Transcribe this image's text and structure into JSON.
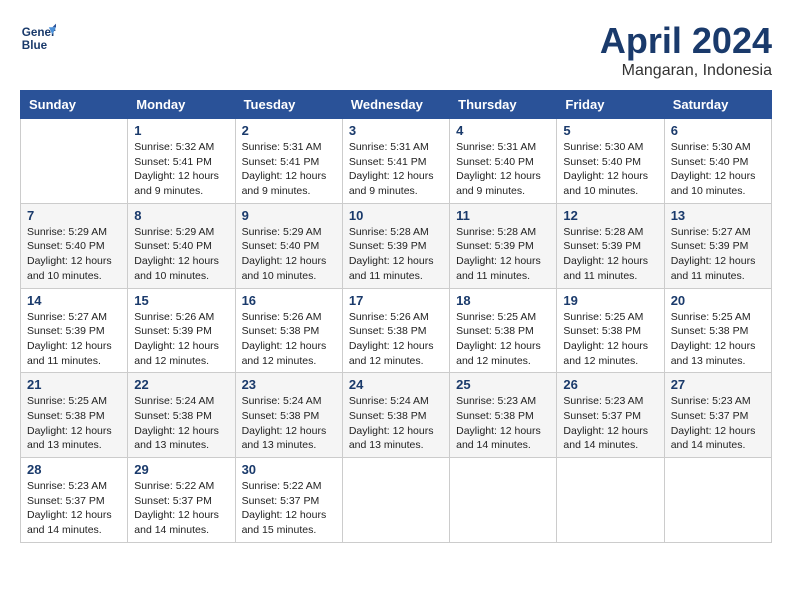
{
  "header": {
    "logo_line1": "General",
    "logo_line2": "Blue",
    "month": "April 2024",
    "location": "Mangaran, Indonesia"
  },
  "days_of_week": [
    "Sunday",
    "Monday",
    "Tuesday",
    "Wednesday",
    "Thursday",
    "Friday",
    "Saturday"
  ],
  "weeks": [
    [
      {
        "day": "",
        "info": ""
      },
      {
        "day": "1",
        "info": "Sunrise: 5:32 AM\nSunset: 5:41 PM\nDaylight: 12 hours\nand 9 minutes."
      },
      {
        "day": "2",
        "info": "Sunrise: 5:31 AM\nSunset: 5:41 PM\nDaylight: 12 hours\nand 9 minutes."
      },
      {
        "day": "3",
        "info": "Sunrise: 5:31 AM\nSunset: 5:41 PM\nDaylight: 12 hours\nand 9 minutes."
      },
      {
        "day": "4",
        "info": "Sunrise: 5:31 AM\nSunset: 5:40 PM\nDaylight: 12 hours\nand 9 minutes."
      },
      {
        "day": "5",
        "info": "Sunrise: 5:30 AM\nSunset: 5:40 PM\nDaylight: 12 hours\nand 10 minutes."
      },
      {
        "day": "6",
        "info": "Sunrise: 5:30 AM\nSunset: 5:40 PM\nDaylight: 12 hours\nand 10 minutes."
      }
    ],
    [
      {
        "day": "7",
        "info": "Sunrise: 5:29 AM\nSunset: 5:40 PM\nDaylight: 12 hours\nand 10 minutes."
      },
      {
        "day": "8",
        "info": "Sunrise: 5:29 AM\nSunset: 5:40 PM\nDaylight: 12 hours\nand 10 minutes."
      },
      {
        "day": "9",
        "info": "Sunrise: 5:29 AM\nSunset: 5:40 PM\nDaylight: 12 hours\nand 10 minutes."
      },
      {
        "day": "10",
        "info": "Sunrise: 5:28 AM\nSunset: 5:39 PM\nDaylight: 12 hours\nand 11 minutes."
      },
      {
        "day": "11",
        "info": "Sunrise: 5:28 AM\nSunset: 5:39 PM\nDaylight: 12 hours\nand 11 minutes."
      },
      {
        "day": "12",
        "info": "Sunrise: 5:28 AM\nSunset: 5:39 PM\nDaylight: 12 hours\nand 11 minutes."
      },
      {
        "day": "13",
        "info": "Sunrise: 5:27 AM\nSunset: 5:39 PM\nDaylight: 12 hours\nand 11 minutes."
      }
    ],
    [
      {
        "day": "14",
        "info": "Sunrise: 5:27 AM\nSunset: 5:39 PM\nDaylight: 12 hours\nand 11 minutes."
      },
      {
        "day": "15",
        "info": "Sunrise: 5:26 AM\nSunset: 5:39 PM\nDaylight: 12 hours\nand 12 minutes."
      },
      {
        "day": "16",
        "info": "Sunrise: 5:26 AM\nSunset: 5:38 PM\nDaylight: 12 hours\nand 12 minutes."
      },
      {
        "day": "17",
        "info": "Sunrise: 5:26 AM\nSunset: 5:38 PM\nDaylight: 12 hours\nand 12 minutes."
      },
      {
        "day": "18",
        "info": "Sunrise: 5:25 AM\nSunset: 5:38 PM\nDaylight: 12 hours\nand 12 minutes."
      },
      {
        "day": "19",
        "info": "Sunrise: 5:25 AM\nSunset: 5:38 PM\nDaylight: 12 hours\nand 12 minutes."
      },
      {
        "day": "20",
        "info": "Sunrise: 5:25 AM\nSunset: 5:38 PM\nDaylight: 12 hours\nand 13 minutes."
      }
    ],
    [
      {
        "day": "21",
        "info": "Sunrise: 5:25 AM\nSunset: 5:38 PM\nDaylight: 12 hours\nand 13 minutes."
      },
      {
        "day": "22",
        "info": "Sunrise: 5:24 AM\nSunset: 5:38 PM\nDaylight: 12 hours\nand 13 minutes."
      },
      {
        "day": "23",
        "info": "Sunrise: 5:24 AM\nSunset: 5:38 PM\nDaylight: 12 hours\nand 13 minutes."
      },
      {
        "day": "24",
        "info": "Sunrise: 5:24 AM\nSunset: 5:38 PM\nDaylight: 12 hours\nand 13 minutes."
      },
      {
        "day": "25",
        "info": "Sunrise: 5:23 AM\nSunset: 5:38 PM\nDaylight: 12 hours\nand 14 minutes."
      },
      {
        "day": "26",
        "info": "Sunrise: 5:23 AM\nSunset: 5:37 PM\nDaylight: 12 hours\nand 14 minutes."
      },
      {
        "day": "27",
        "info": "Sunrise: 5:23 AM\nSunset: 5:37 PM\nDaylight: 12 hours\nand 14 minutes."
      }
    ],
    [
      {
        "day": "28",
        "info": "Sunrise: 5:23 AM\nSunset: 5:37 PM\nDaylight: 12 hours\nand 14 minutes."
      },
      {
        "day": "29",
        "info": "Sunrise: 5:22 AM\nSunset: 5:37 PM\nDaylight: 12 hours\nand 14 minutes."
      },
      {
        "day": "30",
        "info": "Sunrise: 5:22 AM\nSunset: 5:37 PM\nDaylight: 12 hours\nand 15 minutes."
      },
      {
        "day": "",
        "info": ""
      },
      {
        "day": "",
        "info": ""
      },
      {
        "day": "",
        "info": ""
      },
      {
        "day": "",
        "info": ""
      }
    ]
  ]
}
